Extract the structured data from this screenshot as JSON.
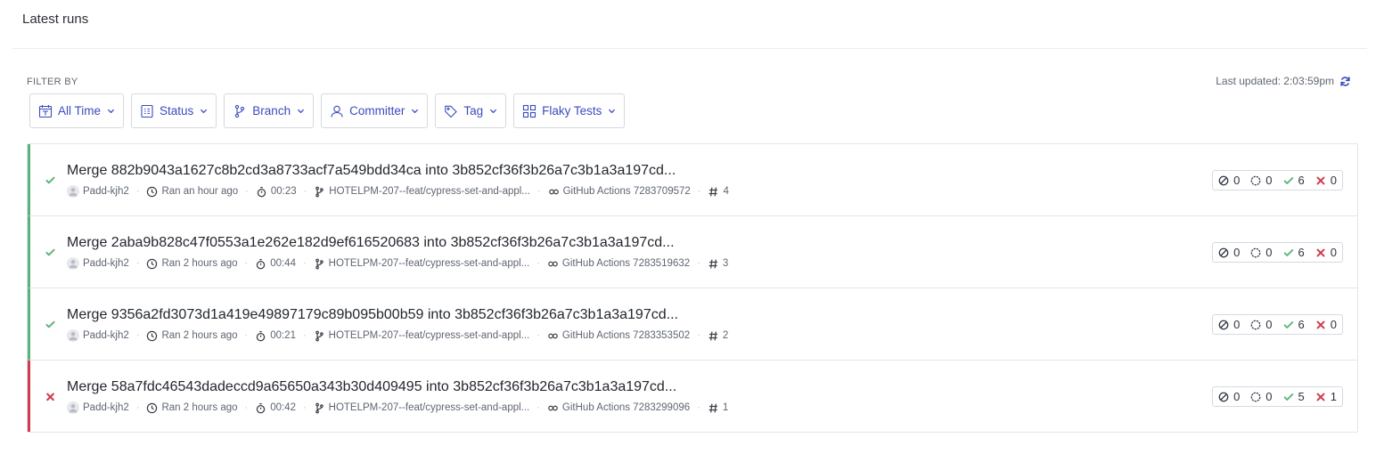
{
  "section": {
    "title": "Latest runs"
  },
  "filter": {
    "label": "FILTER BY",
    "last_updated": "Last updated: 2:03:59pm",
    "buttons": [
      {
        "label": "All Time",
        "icon": "calendar-icon"
      },
      {
        "label": "Status",
        "icon": "status-icon"
      },
      {
        "label": "Branch",
        "icon": "branch-icon"
      },
      {
        "label": "Committer",
        "icon": "user-icon"
      },
      {
        "label": "Tag",
        "icon": "tag-icon"
      },
      {
        "label": "Flaky Tests",
        "icon": "flaky-tests-icon"
      }
    ]
  },
  "colors": {
    "accent": "#3b4bbf",
    "passed": "#5bb27a",
    "failed": "#cf3c4e"
  },
  "runs": [
    {
      "status": "passed",
      "title": "Merge 882b9043a1627c8b2cd3a8733acf7a549bdd34ca into 3b852cf36f3b26a7c3b1a3a197cd...",
      "committer": "Padd-kjh2",
      "ran": "Ran an hour ago",
      "duration": "00:23",
      "branch": "HOTELPM-207--feat/cypress-set-and-appl...",
      "ci": "GitHub Actions 7283709572",
      "run_number": "4",
      "counts": {
        "skipped": "0",
        "pending": "0",
        "passed": "6",
        "failed": "0"
      }
    },
    {
      "status": "passed",
      "title": "Merge 2aba9b828c47f0553a1e262e182d9ef616520683 into 3b852cf36f3b26a7c3b1a3a197cd...",
      "committer": "Padd-kjh2",
      "ran": "Ran 2 hours ago",
      "duration": "00:44",
      "branch": "HOTELPM-207--feat/cypress-set-and-appl...",
      "ci": "GitHub Actions 7283519632",
      "run_number": "3",
      "counts": {
        "skipped": "0",
        "pending": "0",
        "passed": "6",
        "failed": "0"
      }
    },
    {
      "status": "passed",
      "title": "Merge 9356a2fd3073d1a419e49897179c89b095b00b59 into 3b852cf36f3b26a7c3b1a3a197cd...",
      "committer": "Padd-kjh2",
      "ran": "Ran 2 hours ago",
      "duration": "00:21",
      "branch": "HOTELPM-207--feat/cypress-set-and-appl...",
      "ci": "GitHub Actions 7283353502",
      "run_number": "2",
      "counts": {
        "skipped": "0",
        "pending": "0",
        "passed": "6",
        "failed": "0"
      }
    },
    {
      "status": "failed",
      "title": "Merge 58a7fdc46543dadeccd9a65650a343b30d409495 into 3b852cf36f3b26a7c3b1a3a197cd...",
      "committer": "Padd-kjh2",
      "ran": "Ran 2 hours ago",
      "duration": "00:42",
      "branch": "HOTELPM-207--feat/cypress-set-and-appl...",
      "ci": "GitHub Actions 7283299096",
      "run_number": "1",
      "counts": {
        "skipped": "0",
        "pending": "0",
        "passed": "5",
        "failed": "1"
      }
    }
  ]
}
